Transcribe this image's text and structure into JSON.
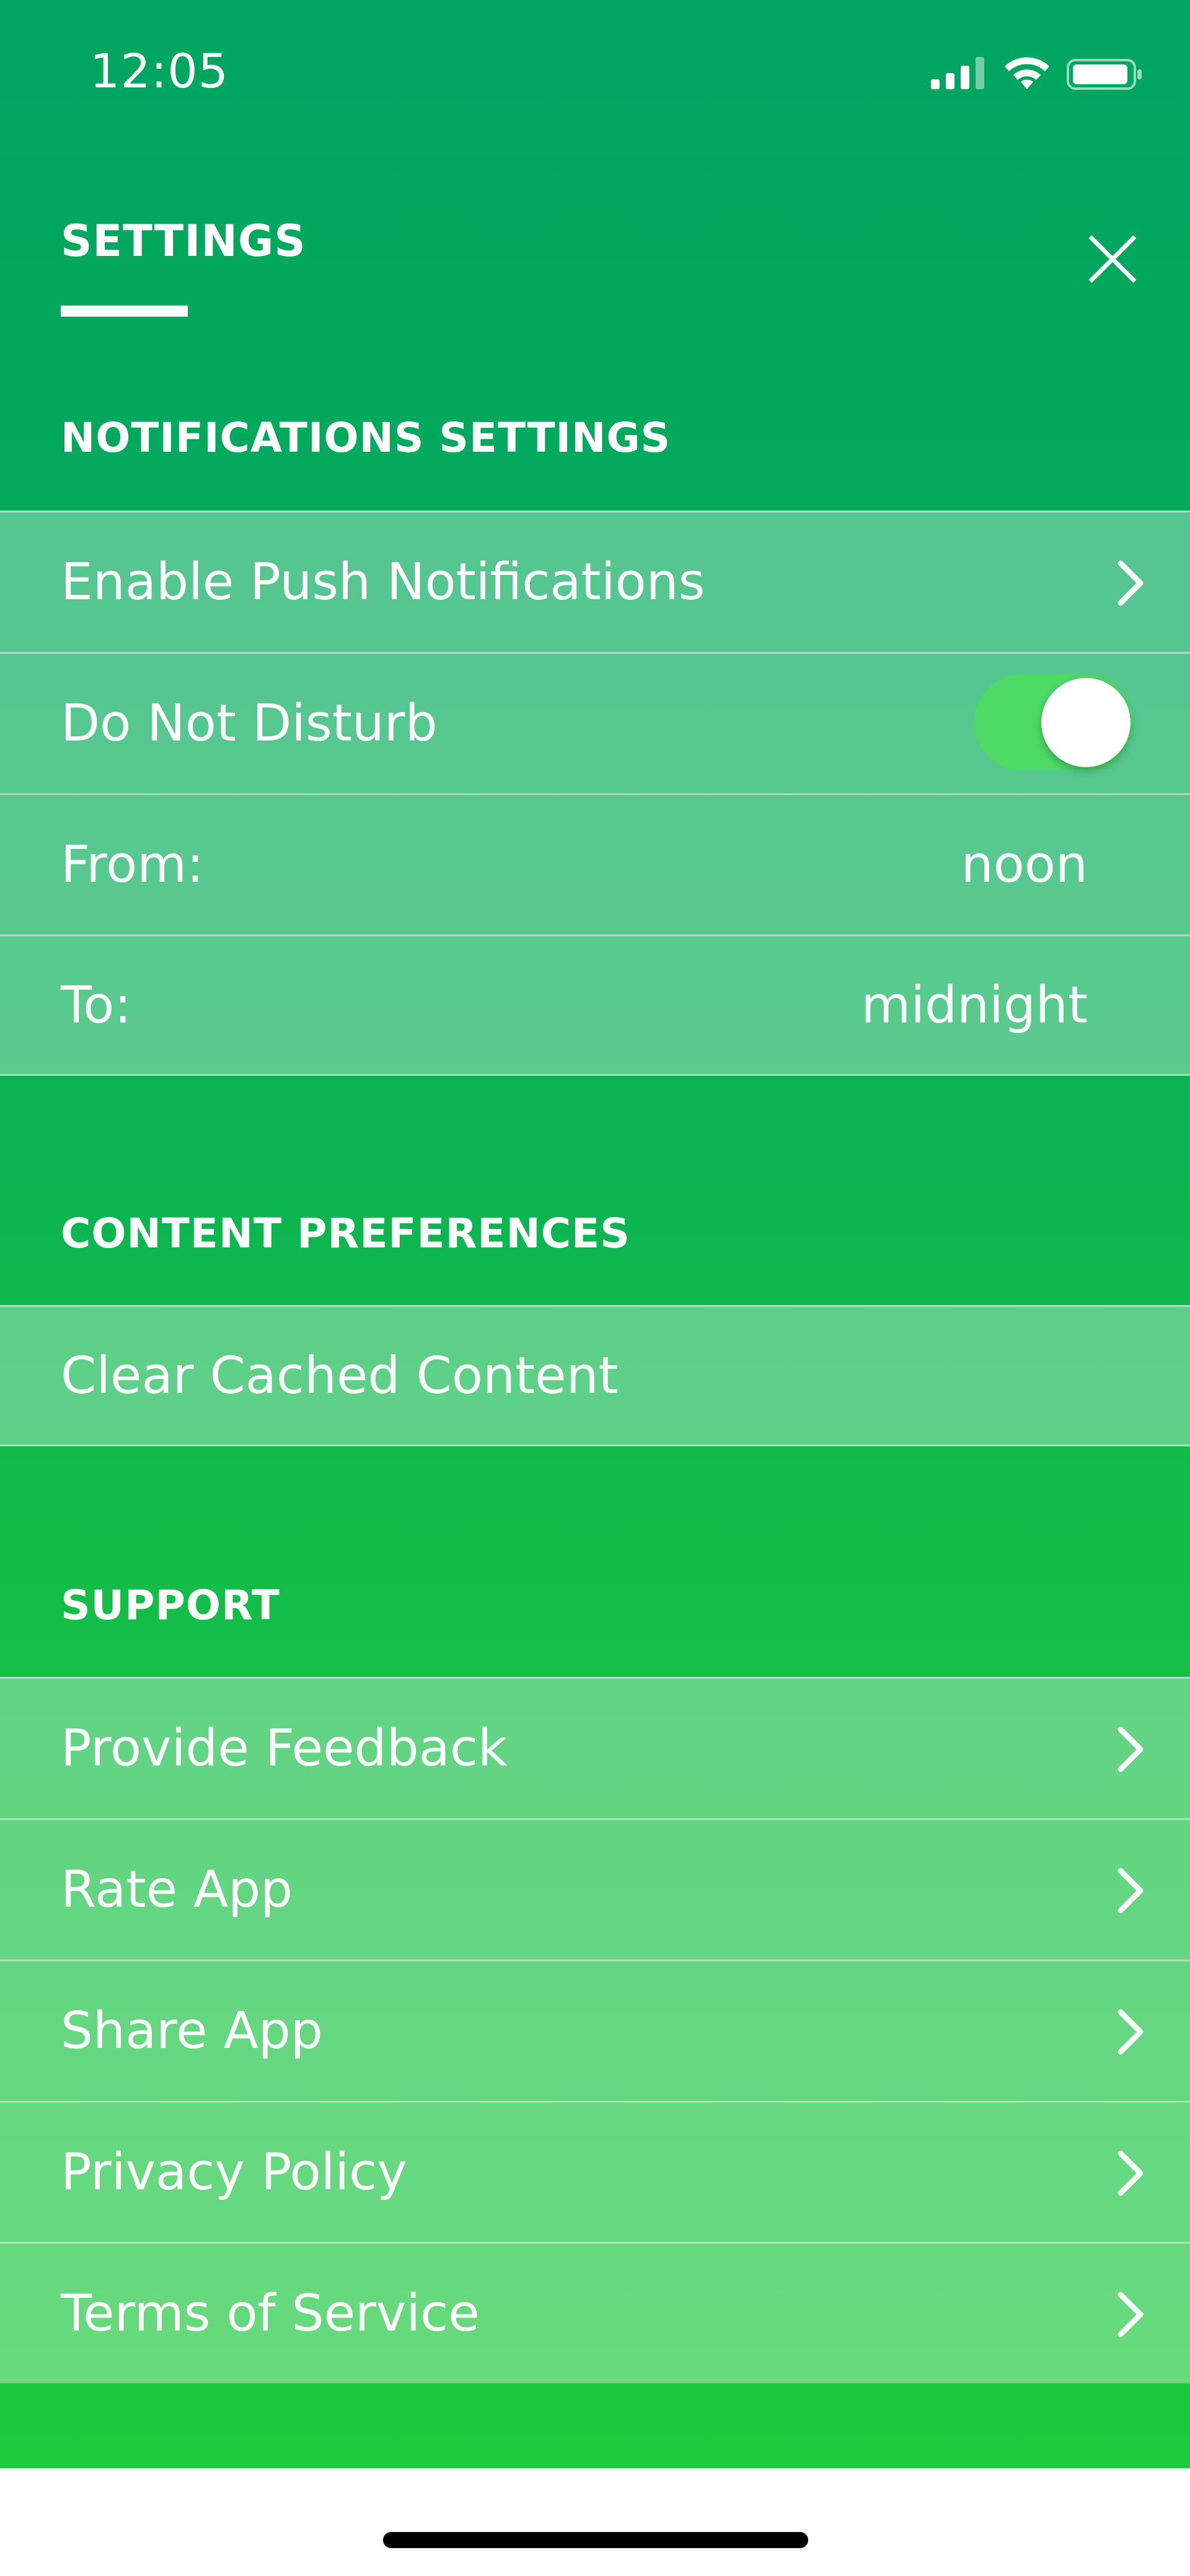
{
  "status_bar": {
    "time": "12:05",
    "signal_icon": "cellular-signal-icon",
    "wifi_icon": "wifi-icon",
    "battery_icon": "battery-icon"
  },
  "header": {
    "title": "SETTINGS",
    "close_icon": "close-icon"
  },
  "sections": {
    "notifications": {
      "title": "NOTIFICATIONS SETTINGS",
      "enable_push": "Enable Push Notifications",
      "do_not_disturb": "Do Not Disturb",
      "do_not_disturb_on": true,
      "from_label": "From:",
      "from_value": "noon",
      "to_label": "To:",
      "to_value": "midnight"
    },
    "content": {
      "title": "CONTENT PREFERENCES",
      "clear_cache": "Clear Cached Content"
    },
    "support": {
      "title": "SUPPORT",
      "items": [
        "Provide Feedback",
        "Rate App",
        "Share App",
        "Privacy Policy",
        "Terms of Service"
      ]
    }
  },
  "colors": {
    "panel_top": "#00a560",
    "panel_bottom": "#1fc93c",
    "toggle_on": "#4cd964",
    "text": "#ffffff"
  }
}
